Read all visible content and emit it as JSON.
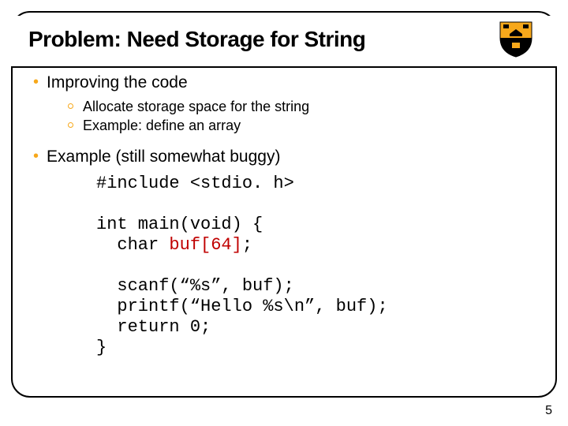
{
  "title": "Problem: Need Storage for String",
  "bullets": {
    "b1": "Improving the code",
    "b1_subs": [
      "Allocate storage space for the string",
      "Example: define an array"
    ],
    "b2": "Example (still somewhat buggy)"
  },
  "code": {
    "line1": "#include <stdio. h>",
    "line2": "",
    "line3": "int main(void) {",
    "line4_pre": "  char ",
    "line4_hl": "buf[64]",
    "line4_post": ";",
    "line5": "",
    "line6": "  scanf(“%s”, buf);",
    "line7": "  printf(“Hello %s\\n”, buf);",
    "line8": "  return 0;",
    "line9": "}"
  },
  "page_number": "5",
  "shield_colors": {
    "orange": "#f7a81b",
    "black": "#000"
  }
}
